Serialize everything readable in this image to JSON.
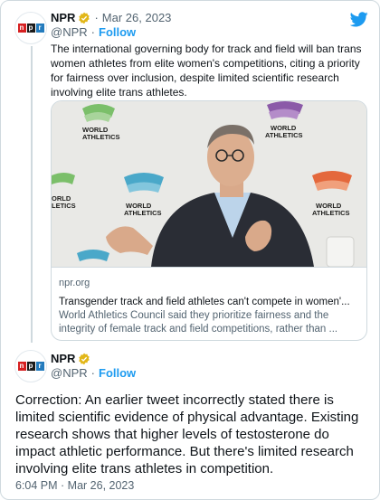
{
  "brand": {
    "twitter_blue": "#1d9bf0",
    "npr_red": "#d62021",
    "npr_black": "#1a1a1a",
    "npr_blue": "#237bbd"
  },
  "tweet1": {
    "author": "NPR",
    "date_sep": "·",
    "date": "Mar 26, 2023",
    "logo_letters": [
      "n",
      "p",
      "r"
    ],
    "text": "The international governing body for track and field will ban trans women athletes from elite women's competitions, citing a priority for fairness over inclusion, despite limited scientific research involving elite trans athletes.",
    "card": {
      "backdrop_text": [
        "WORLD",
        "ATHLETICS"
      ],
      "backdrop_text_cut": [
        "ORLD",
        "LETICS"
      ],
      "domain": "npr.org",
      "title": "Transgender track and field athletes can't compete in women'...",
      "description": "World Athletics Council said they prioritize fairness and the integrity of female track and field competitions, rather than ..."
    }
  },
  "tweet2": {
    "author": "NPR",
    "handle": "@NPR",
    "follow_sep": "·",
    "follow_label": "Follow",
    "logo_letters": [
      "n",
      "p",
      "r"
    ],
    "text": "Correction: An earlier tweet incorrectly stated there is limited scientific evidence of physical advantage. Existing research shows that higher levels of testosterone do impact athletic performance. But there's limited research involving elite trans athletes in competition.",
    "timestamp": "6:04 PM · Mar 26, 2023"
  },
  "header1": {
    "handle": "@NPR",
    "follow_sep": "·",
    "follow_label": "Follow"
  },
  "icons": {
    "verified": "verified-badge-icon",
    "twitter": "twitter-bird-icon"
  }
}
